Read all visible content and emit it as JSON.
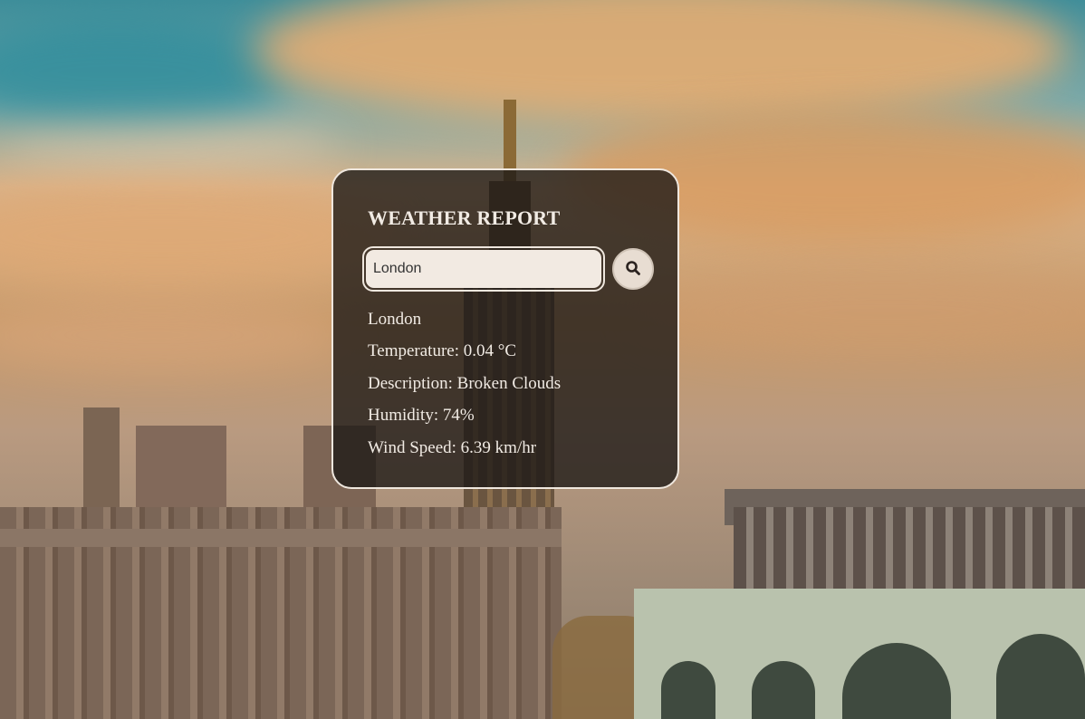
{
  "app": {
    "title": "WEATHER REPORT"
  },
  "search": {
    "value": "London",
    "button_icon": "search-icon"
  },
  "result": {
    "city": "London",
    "temperature": "Temperature: 0.04 °C",
    "description": "Description: Broken Clouds",
    "humidity": "Humidity: 74%",
    "wind_speed": "Wind Speed: 6.39 km/hr"
  },
  "colors": {
    "card_border": "#efe7de",
    "card_background": "rgba(28,24,22,0.78)",
    "text": "#f1ebe4",
    "input_background": "#f2eae2"
  }
}
